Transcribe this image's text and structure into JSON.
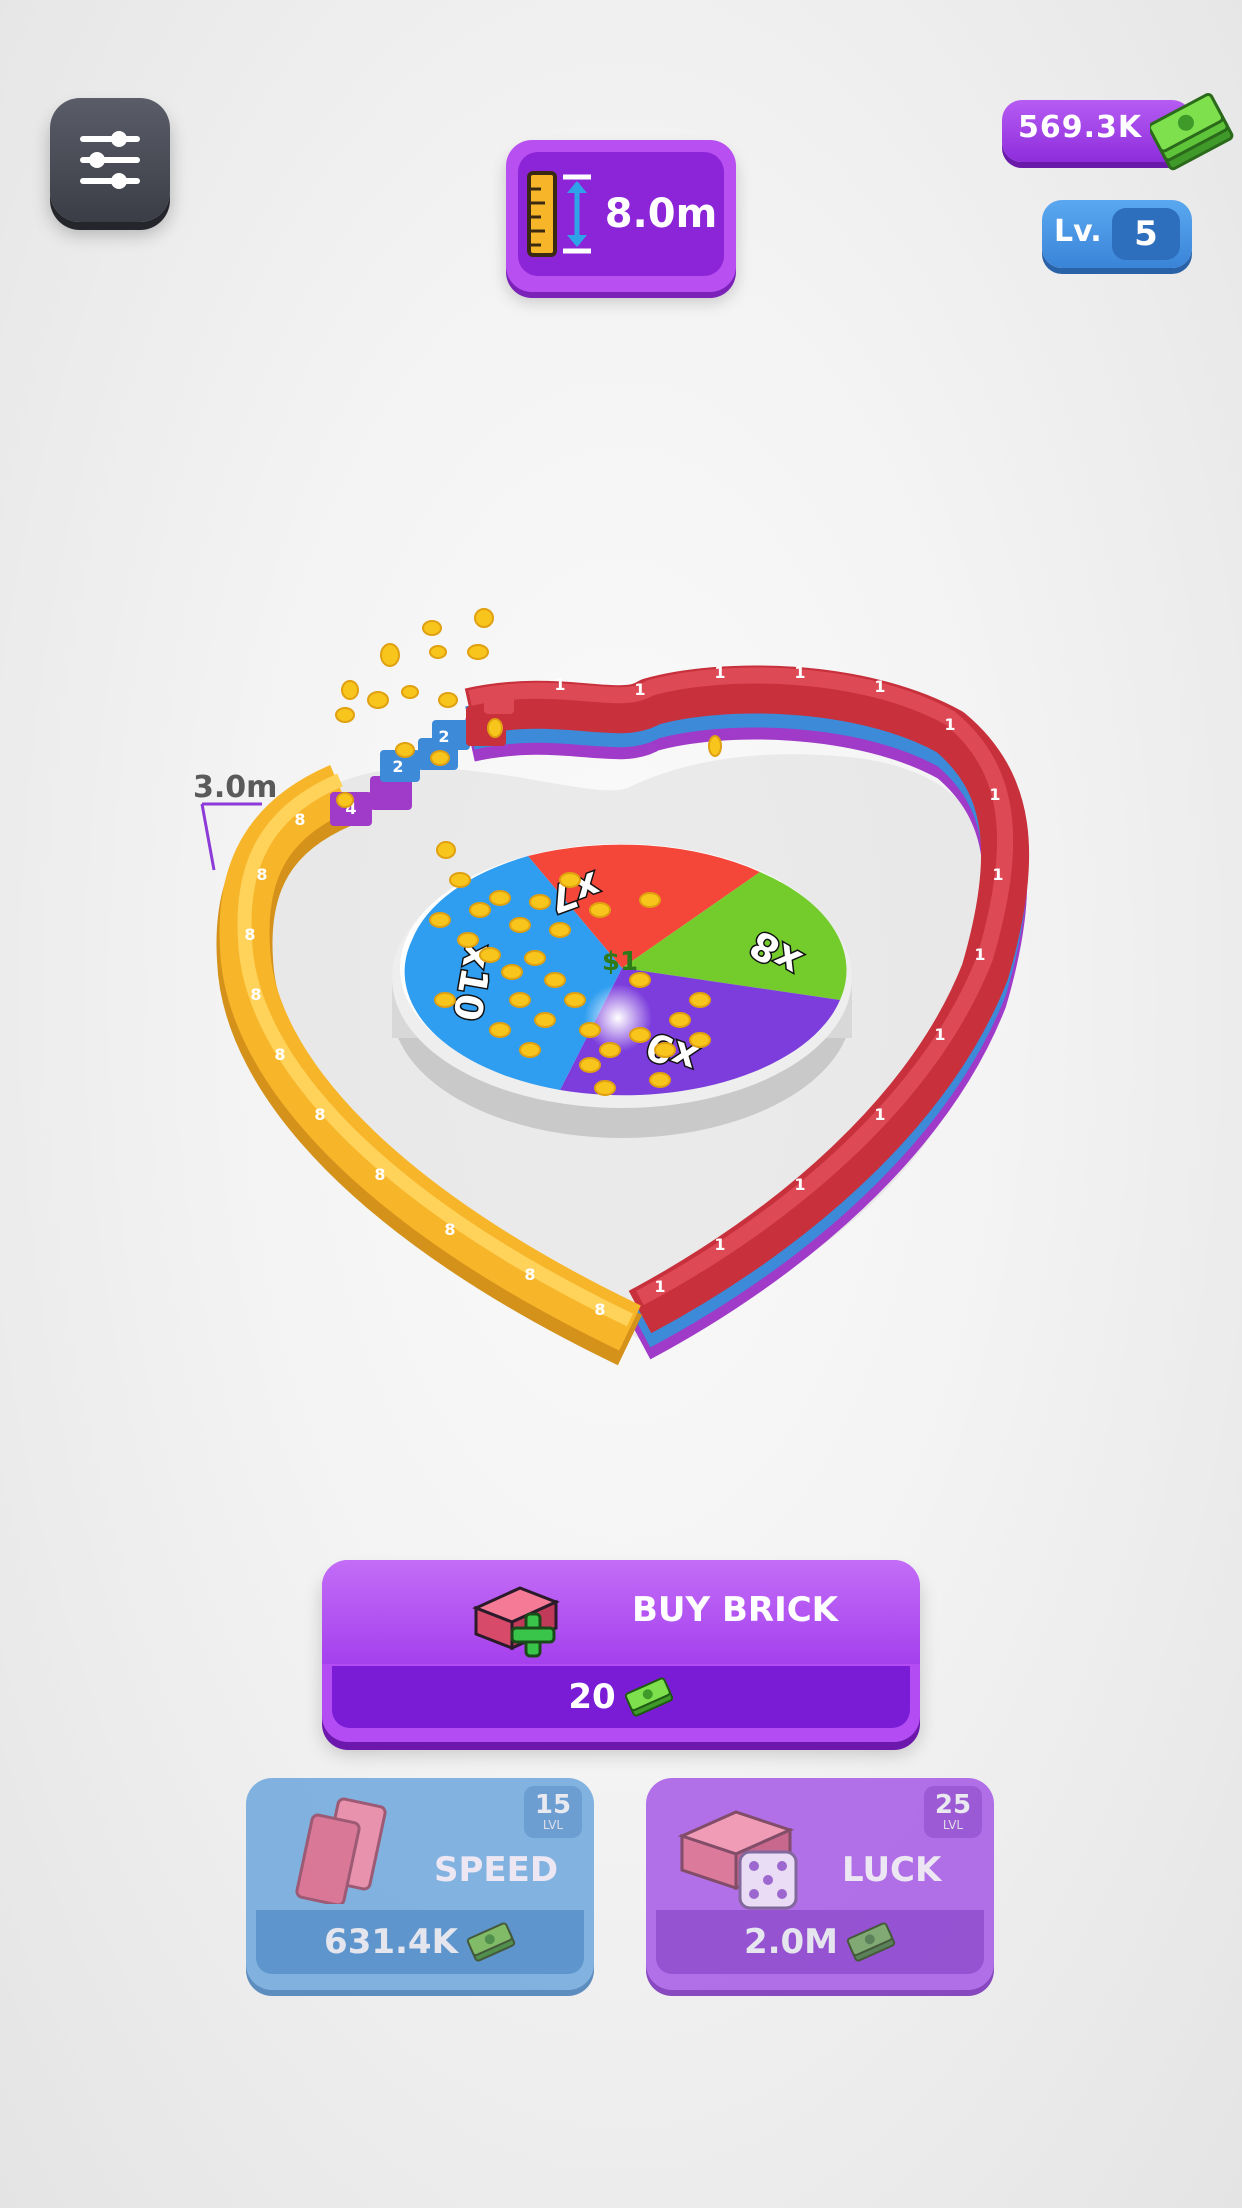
{
  "hud": {
    "height_value": "8.0m",
    "money": "569.3K",
    "level_prefix": "Lv.",
    "level": "5"
  },
  "board": {
    "height_marker": "3.0m",
    "wheel": {
      "segments": [
        {
          "label": "x7",
          "color": "#f4473a"
        },
        {
          "label": "x8",
          "color": "#74cc2c"
        },
        {
          "label": "x9",
          "color": "#7c3ddc"
        },
        {
          "label": "x10",
          "color": "#2f9df0"
        }
      ],
      "center_label": "$1"
    },
    "brick_colors": {
      "red": "#c8303c",
      "yellow": "#f7b52a",
      "blue": "#3c8ad8",
      "purple": "#a03ac8"
    },
    "red_brick_value": "1",
    "yellow_brick_value": "8",
    "blue_brick_value": "2",
    "purple_brick_value": "4"
  },
  "buy_brick": {
    "label": "BUY BRICK",
    "cost": "20"
  },
  "upgrades": [
    {
      "name": "SPEED",
      "cost": "631.4K",
      "level": "15",
      "level_sub": "LVL"
    },
    {
      "name": "LUCK",
      "cost": "2.0M",
      "level": "25",
      "level_sub": "LVL"
    }
  ]
}
